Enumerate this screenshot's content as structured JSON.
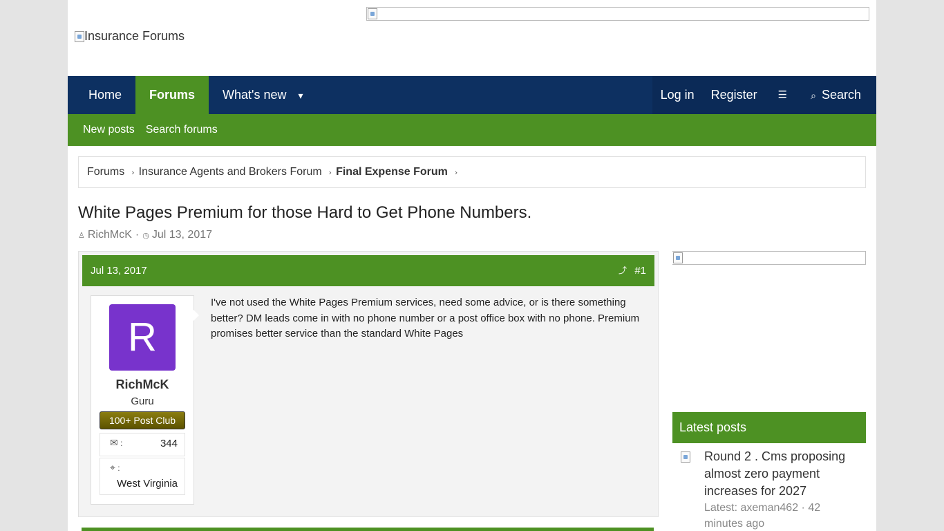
{
  "header": {
    "logo_alt": "Insurance Forums"
  },
  "nav": {
    "items": [
      {
        "label": "Home"
      },
      {
        "label": "Forums"
      },
      {
        "label": "What's new"
      }
    ],
    "login": "Log in",
    "register": "Register",
    "search": "Search"
  },
  "subnav": {
    "items": [
      "New posts",
      "Search forums"
    ]
  },
  "breadcrumb": {
    "items": [
      "Forums",
      "Insurance Agents and Brokers Forum",
      "Final Expense Forum"
    ]
  },
  "thread": {
    "title": "White Pages Premium for those Hard to Get Phone Numbers.",
    "author": "RichMcK",
    "date": "Jul 13, 2017"
  },
  "post": {
    "date": "Jul 13, 2017",
    "number": "#1",
    "user": {
      "avatar_letter": "R",
      "name": "RichMcK",
      "title": "Guru",
      "badge": "100+ Post Club",
      "messages_label": ":",
      "messages": "344",
      "location_label": ":",
      "location": "West Virginia"
    },
    "body": "I've not used the White Pages Premium services, need some advice, or is there something better? DM leads come in with no phone number or a post office box with no phone. Premium promises better service than the standard White Pages"
  },
  "sidebar": {
    "latest_title": "Latest posts",
    "latest": [
      {
        "title": "Round 2 . Cms proposing almost zero payment increases for 2027",
        "meta": "Latest: axeman462 · 42 minutes ago"
      }
    ]
  },
  "colors": {
    "nav_bg": "#0d3061",
    "accent_green": "#4d9123",
    "avatar_bg": "#7833cc",
    "badge_bg": "#6f6505"
  }
}
